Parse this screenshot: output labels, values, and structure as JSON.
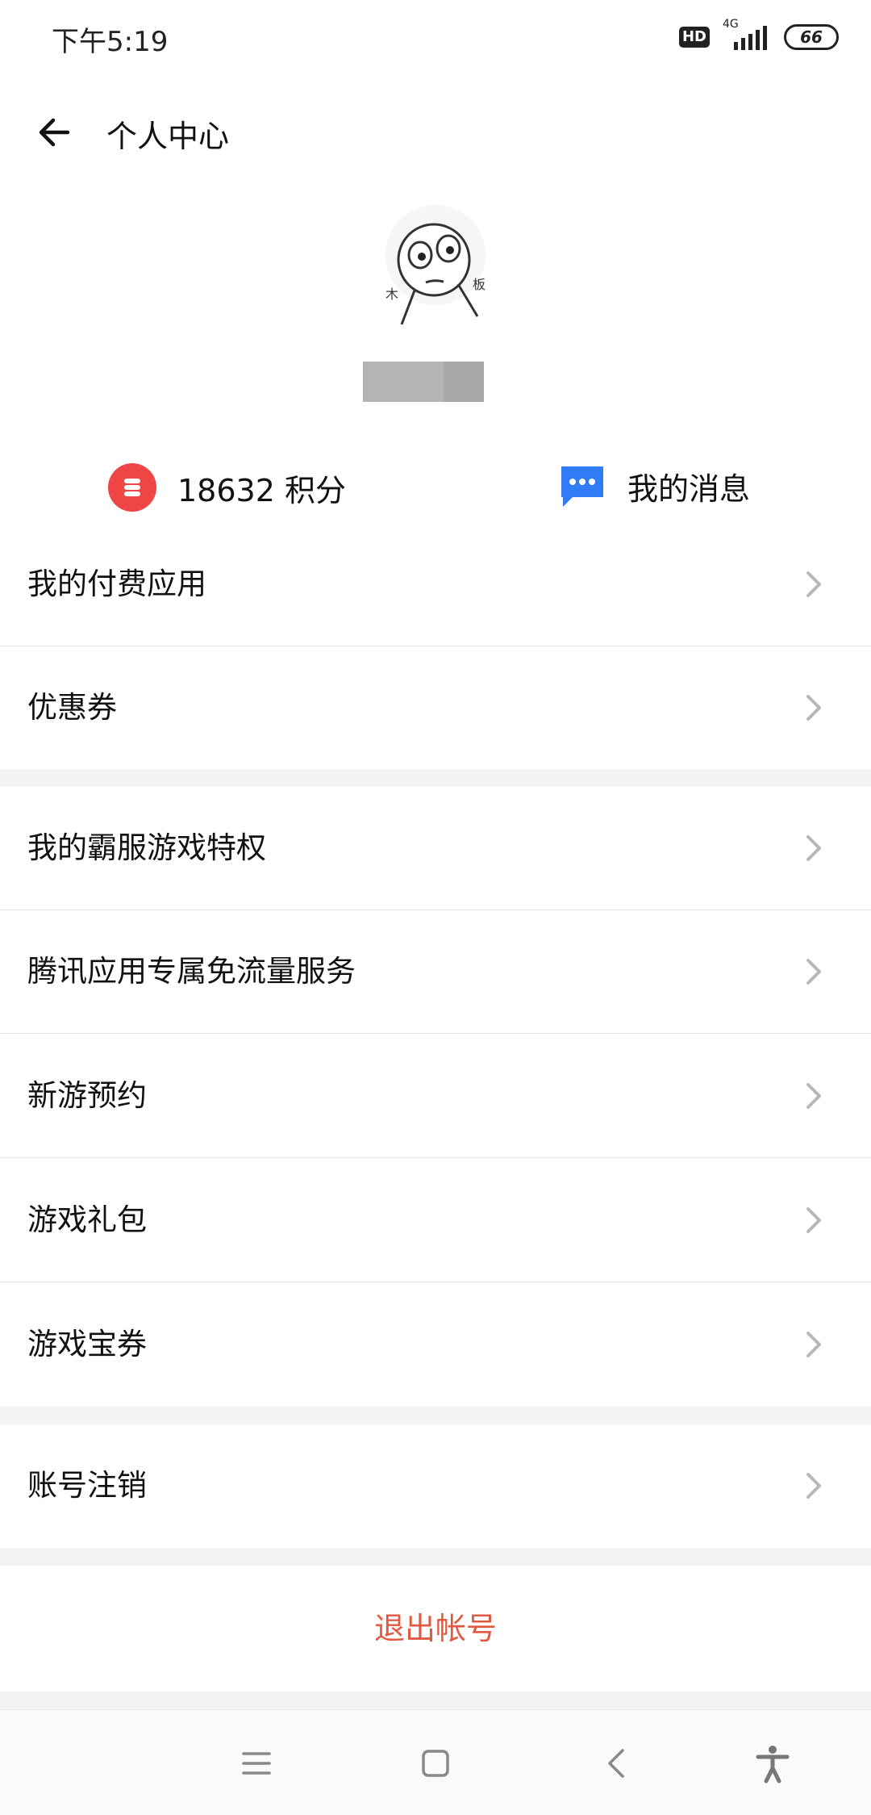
{
  "status_bar": {
    "time": "下午5:19",
    "hd": "HD",
    "network": "4G",
    "battery": "66"
  },
  "header": {
    "title": "个人中心",
    "back_icon": "arrow-left-icon"
  },
  "profile": {
    "avatar_text_left": "木",
    "avatar_text_right": "板"
  },
  "stats": {
    "points": "18632 积分",
    "messages": "我的消息",
    "points_color": "#ef4545",
    "messages_color": "#2f7cf6"
  },
  "menu": {
    "group1": [
      "我的付费应用",
      "优惠券"
    ],
    "group2": [
      "我的霸服游戏特权",
      "腾讯应用专属免流量服务",
      "新游预约",
      "游戏礼包",
      "游戏宝券"
    ],
    "group3": [
      "账号注销"
    ]
  },
  "logout": {
    "label": "退出帐号",
    "color": "#e05a42"
  },
  "nav_bar": {
    "icons": [
      "menu-icon",
      "home-square-icon",
      "back-chevron-icon",
      "accessibility-icon"
    ]
  }
}
